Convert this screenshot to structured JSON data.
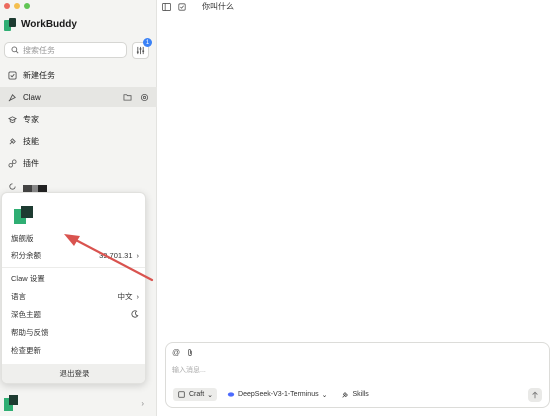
{
  "app": {
    "name": "WorkBuddy"
  },
  "search": {
    "placeholder": "搜索任务"
  },
  "filter": {
    "badge": "1"
  },
  "nav": {
    "items": [
      {
        "label": "新建任务",
        "icon": "new-task-icon"
      },
      {
        "label": "Claw",
        "icon": "claw-icon",
        "active": true
      },
      {
        "label": "专家",
        "icon": "expert-icon"
      },
      {
        "label": "技能",
        "icon": "skill-icon"
      },
      {
        "label": "插件",
        "icon": "plugin-icon"
      }
    ]
  },
  "popup": {
    "plan": "旗舰版",
    "points_label": "积分余额",
    "points_value": "39,701.31",
    "claw_settings": "Claw 设置",
    "language_label": "语言",
    "language_value": "中文",
    "dark_theme": "深色主题",
    "help": "帮助与反馈",
    "check_update": "检查更新",
    "logout": "退出登录"
  },
  "main": {
    "title": "你叫什么"
  },
  "composer": {
    "placeholder": "输入消息...",
    "mode": "Craft",
    "model": "DeepSeek-V3-1-Terminus",
    "skills": "Skills"
  },
  "colors": {
    "accent": "#3b82f6",
    "brand_green": "#2fae73",
    "brand_dark": "#1d3b31",
    "arrow": "#d9534f"
  }
}
